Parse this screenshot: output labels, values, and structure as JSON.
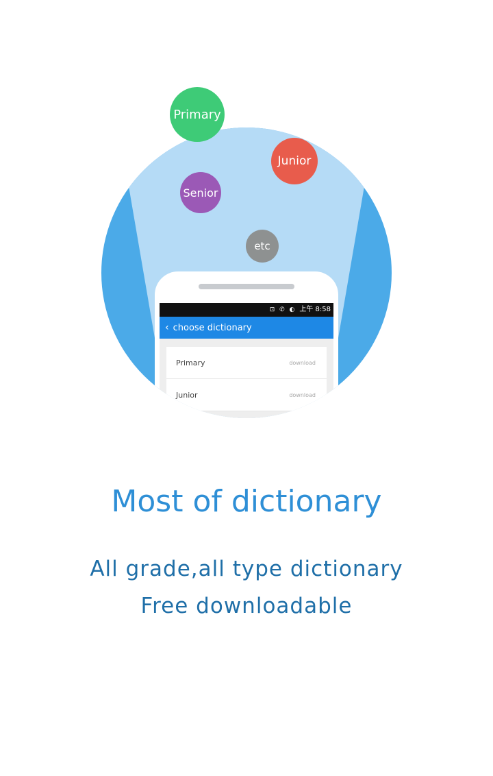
{
  "illustration": {
    "bubbles": {
      "primary": "Primary",
      "junior": "Junior",
      "senior": "Senior",
      "etc": "etc"
    },
    "phone": {
      "status_icons": "⊡ ✆ ◐",
      "status_time": "上午 8:58",
      "app_bar_title": "choose dictionary",
      "back_icon": "‹",
      "list": [
        {
          "name": "Primary",
          "action": "download"
        },
        {
          "name": "Junior",
          "action": "download"
        }
      ]
    },
    "colors": {
      "primary": "#3ecb77",
      "junior": "#e85c4c",
      "senior": "#9b59b6",
      "etc": "#8e9191",
      "circle": "#4baae8",
      "app_bar": "#1e88e5"
    }
  },
  "content": {
    "headline": "Most of dictionary",
    "line1": "All grade,all type dictionary",
    "line2": "Free downloadable"
  }
}
